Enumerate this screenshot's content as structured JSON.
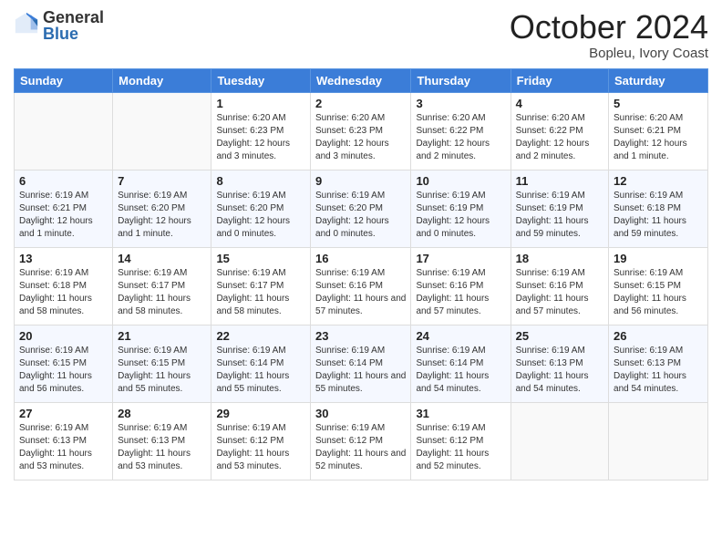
{
  "logo": {
    "general": "General",
    "blue": "Blue"
  },
  "title": "October 2024",
  "subtitle": "Bopleu, Ivory Coast",
  "days_of_week": [
    "Sunday",
    "Monday",
    "Tuesday",
    "Wednesday",
    "Thursday",
    "Friday",
    "Saturday"
  ],
  "weeks": [
    [
      {
        "day": "",
        "info": ""
      },
      {
        "day": "",
        "info": ""
      },
      {
        "day": "1",
        "info": "Sunrise: 6:20 AM\nSunset: 6:23 PM\nDaylight: 12 hours and 3 minutes."
      },
      {
        "day": "2",
        "info": "Sunrise: 6:20 AM\nSunset: 6:23 PM\nDaylight: 12 hours and 3 minutes."
      },
      {
        "day": "3",
        "info": "Sunrise: 6:20 AM\nSunset: 6:22 PM\nDaylight: 12 hours and 2 minutes."
      },
      {
        "day": "4",
        "info": "Sunrise: 6:20 AM\nSunset: 6:22 PM\nDaylight: 12 hours and 2 minutes."
      },
      {
        "day": "5",
        "info": "Sunrise: 6:20 AM\nSunset: 6:21 PM\nDaylight: 12 hours and 1 minute."
      }
    ],
    [
      {
        "day": "6",
        "info": "Sunrise: 6:19 AM\nSunset: 6:21 PM\nDaylight: 12 hours and 1 minute."
      },
      {
        "day": "7",
        "info": "Sunrise: 6:19 AM\nSunset: 6:20 PM\nDaylight: 12 hours and 1 minute."
      },
      {
        "day": "8",
        "info": "Sunrise: 6:19 AM\nSunset: 6:20 PM\nDaylight: 12 hours and 0 minutes."
      },
      {
        "day": "9",
        "info": "Sunrise: 6:19 AM\nSunset: 6:20 PM\nDaylight: 12 hours and 0 minutes."
      },
      {
        "day": "10",
        "info": "Sunrise: 6:19 AM\nSunset: 6:19 PM\nDaylight: 12 hours and 0 minutes."
      },
      {
        "day": "11",
        "info": "Sunrise: 6:19 AM\nSunset: 6:19 PM\nDaylight: 11 hours and 59 minutes."
      },
      {
        "day": "12",
        "info": "Sunrise: 6:19 AM\nSunset: 6:18 PM\nDaylight: 11 hours and 59 minutes."
      }
    ],
    [
      {
        "day": "13",
        "info": "Sunrise: 6:19 AM\nSunset: 6:18 PM\nDaylight: 11 hours and 58 minutes."
      },
      {
        "day": "14",
        "info": "Sunrise: 6:19 AM\nSunset: 6:17 PM\nDaylight: 11 hours and 58 minutes."
      },
      {
        "day": "15",
        "info": "Sunrise: 6:19 AM\nSunset: 6:17 PM\nDaylight: 11 hours and 58 minutes."
      },
      {
        "day": "16",
        "info": "Sunrise: 6:19 AM\nSunset: 6:16 PM\nDaylight: 11 hours and 57 minutes."
      },
      {
        "day": "17",
        "info": "Sunrise: 6:19 AM\nSunset: 6:16 PM\nDaylight: 11 hours and 57 minutes."
      },
      {
        "day": "18",
        "info": "Sunrise: 6:19 AM\nSunset: 6:16 PM\nDaylight: 11 hours and 57 minutes."
      },
      {
        "day": "19",
        "info": "Sunrise: 6:19 AM\nSunset: 6:15 PM\nDaylight: 11 hours and 56 minutes."
      }
    ],
    [
      {
        "day": "20",
        "info": "Sunrise: 6:19 AM\nSunset: 6:15 PM\nDaylight: 11 hours and 56 minutes."
      },
      {
        "day": "21",
        "info": "Sunrise: 6:19 AM\nSunset: 6:15 PM\nDaylight: 11 hours and 55 minutes."
      },
      {
        "day": "22",
        "info": "Sunrise: 6:19 AM\nSunset: 6:14 PM\nDaylight: 11 hours and 55 minutes."
      },
      {
        "day": "23",
        "info": "Sunrise: 6:19 AM\nSunset: 6:14 PM\nDaylight: 11 hours and 55 minutes."
      },
      {
        "day": "24",
        "info": "Sunrise: 6:19 AM\nSunset: 6:14 PM\nDaylight: 11 hours and 54 minutes."
      },
      {
        "day": "25",
        "info": "Sunrise: 6:19 AM\nSunset: 6:13 PM\nDaylight: 11 hours and 54 minutes."
      },
      {
        "day": "26",
        "info": "Sunrise: 6:19 AM\nSunset: 6:13 PM\nDaylight: 11 hours and 54 minutes."
      }
    ],
    [
      {
        "day": "27",
        "info": "Sunrise: 6:19 AM\nSunset: 6:13 PM\nDaylight: 11 hours and 53 minutes."
      },
      {
        "day": "28",
        "info": "Sunrise: 6:19 AM\nSunset: 6:13 PM\nDaylight: 11 hours and 53 minutes."
      },
      {
        "day": "29",
        "info": "Sunrise: 6:19 AM\nSunset: 6:12 PM\nDaylight: 11 hours and 53 minutes."
      },
      {
        "day": "30",
        "info": "Sunrise: 6:19 AM\nSunset: 6:12 PM\nDaylight: 11 hours and 52 minutes."
      },
      {
        "day": "31",
        "info": "Sunrise: 6:19 AM\nSunset: 6:12 PM\nDaylight: 11 hours and 52 minutes."
      },
      {
        "day": "",
        "info": ""
      },
      {
        "day": "",
        "info": ""
      }
    ]
  ]
}
